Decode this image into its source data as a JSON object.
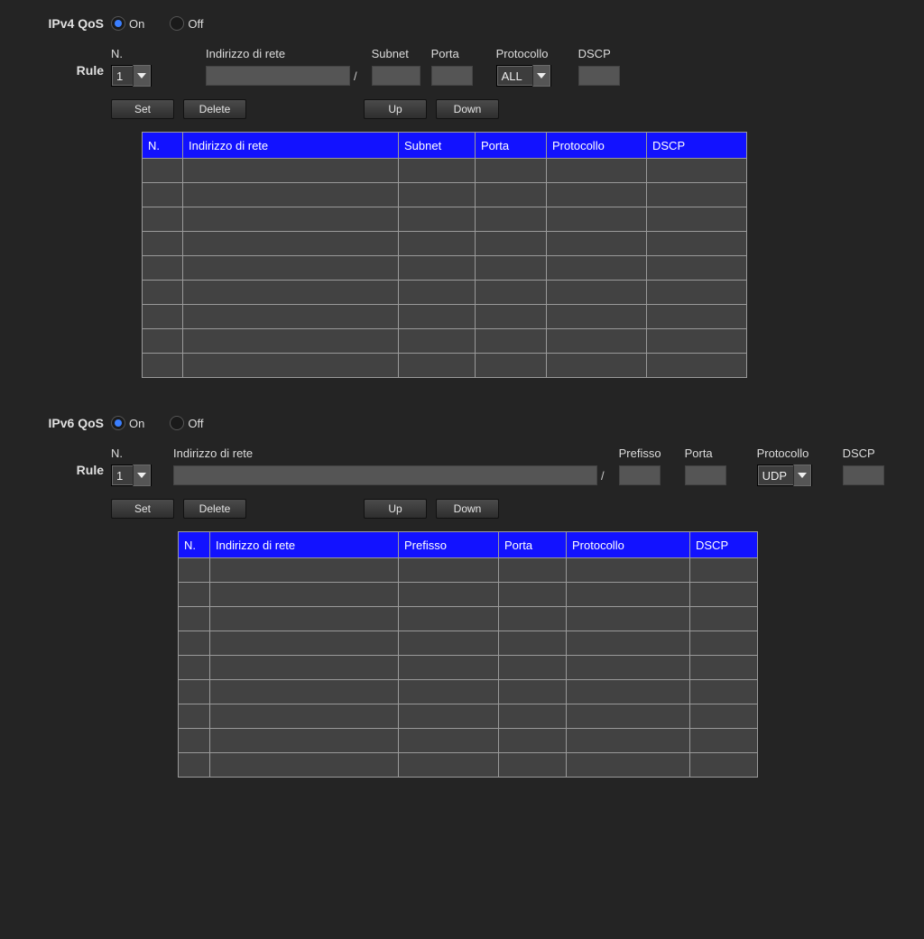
{
  "ipv4": {
    "title": "IPv4 QoS",
    "on_label": "On",
    "off_label": "Off",
    "rule_label": "Rule",
    "n_label": "N.",
    "n_value": "1",
    "addr_label": "Indirizzo di rete",
    "subnet_label": "Subnet",
    "port_label": "Porta",
    "proto_label": "Protocollo",
    "proto_value": "ALL",
    "dscp_label": "DSCP",
    "set_btn": "Set",
    "delete_btn": "Delete",
    "up_btn": "Up",
    "down_btn": "Down",
    "table_headers": {
      "n": "N.",
      "addr": "Indirizzo di rete",
      "subnet": "Subnet",
      "port": "Porta",
      "proto": "Protocollo",
      "dscp": "DSCP"
    }
  },
  "ipv6": {
    "title": "IPv6 QoS",
    "on_label": "On",
    "off_label": "Off",
    "rule_label": "Rule",
    "n_label": "N.",
    "n_value": "1",
    "addr_label": "Indirizzo di rete",
    "prefix_label": "Prefisso",
    "port_label": "Porta",
    "proto_label": "Protocollo",
    "proto_value": "UDP",
    "dscp_label": "DSCP",
    "set_btn": "Set",
    "delete_btn": "Delete",
    "up_btn": "Up",
    "down_btn": "Down",
    "table_headers": {
      "n": "N.",
      "addr": "Indirizzo di rete",
      "prefix": "Prefisso",
      "port": "Porta",
      "proto": "Protocollo",
      "dscp": "DSCP"
    }
  }
}
